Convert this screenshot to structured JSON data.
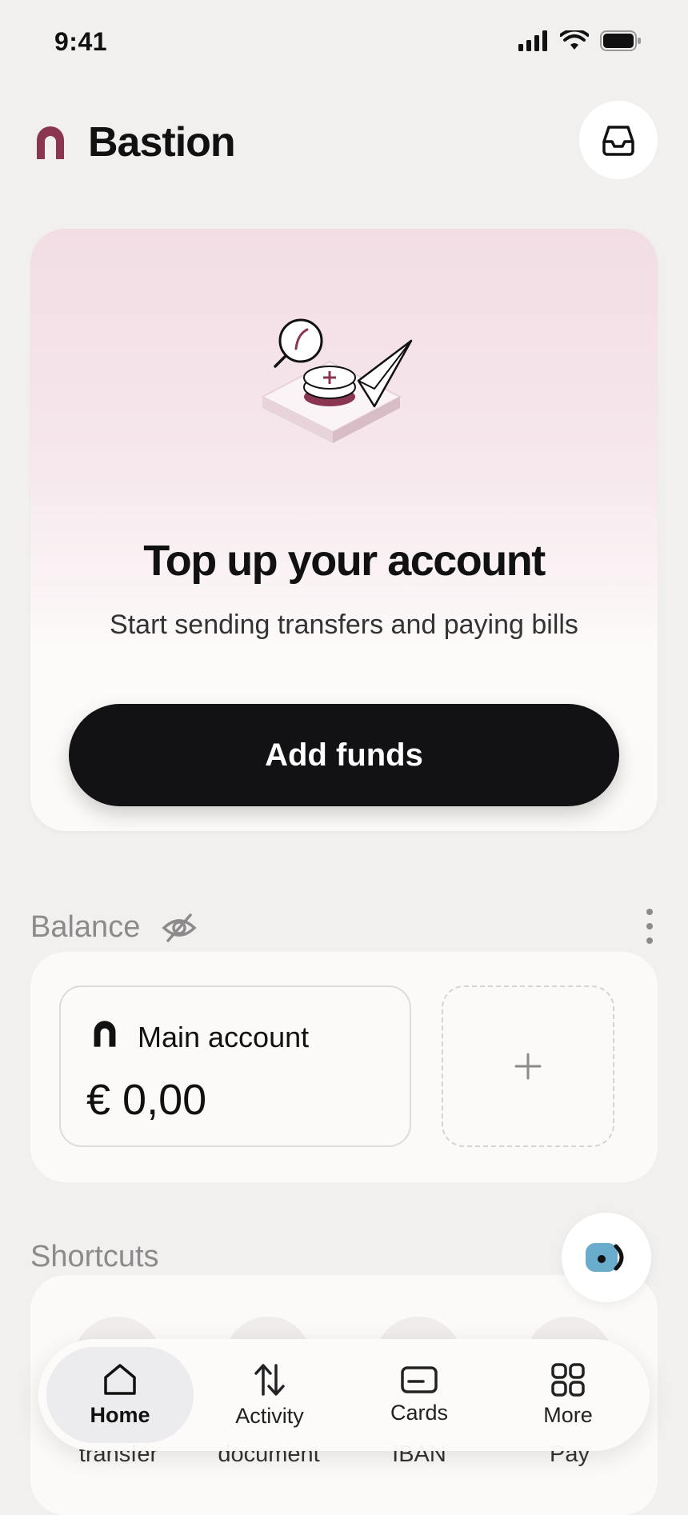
{
  "status_bar": {
    "time": "9:41"
  },
  "header": {
    "title": "Bastion"
  },
  "promo": {
    "title": "Top up your account",
    "subtitle": "Start sending transfers and paying bills",
    "button_label": "Add funds"
  },
  "balance": {
    "label": "Balance",
    "account": {
      "name": "Main account",
      "amount": "€ 0,00"
    }
  },
  "shortcuts": {
    "label": "Shortcuts",
    "items": [
      {
        "label": "transfer"
      },
      {
        "label": "document"
      },
      {
        "label": "IBAN"
      },
      {
        "label": "Pay"
      }
    ]
  },
  "tabs": [
    {
      "label": "Home",
      "icon": "home-icon",
      "active": true
    },
    {
      "label": "Activity",
      "icon": "activity-icon",
      "active": false
    },
    {
      "label": "Cards",
      "icon": "card-icon",
      "active": false
    },
    {
      "label": "More",
      "icon": "grid-icon",
      "active": false
    }
  ],
  "colors": {
    "brand": "#8a3650",
    "button": "#121114",
    "background": "#f1f0ef"
  }
}
